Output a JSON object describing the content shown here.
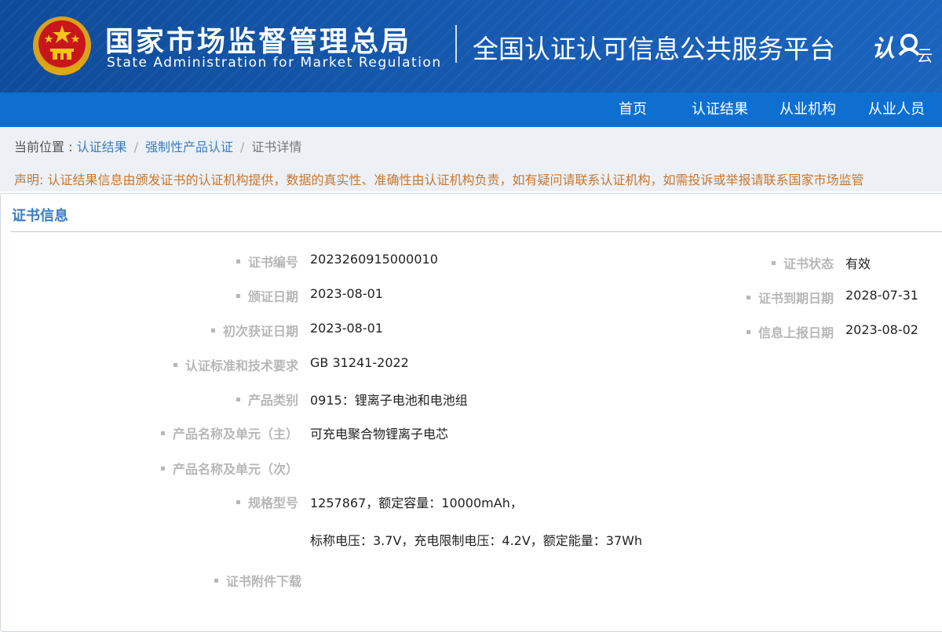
{
  "header": {
    "agency_cn": "国家市场监督管理总局",
    "agency_en": "State Administration  for  Market Regulation",
    "platform_title": "全国认证认可信息公共服务平台",
    "logo_text": "认云"
  },
  "nav": {
    "items": [
      "首页",
      "认证结果",
      "从业机构",
      "从业人员"
    ]
  },
  "breadcrumb": {
    "lead": "当前位置 : ",
    "items": [
      "认证结果",
      "强制性产品认证",
      "证书详情"
    ],
    "separator": "/"
  },
  "notice": "声明: 认证结果信息由颁发证书的认证机构提供，数据的真实性、准确性由认证机构负责，如有疑问请联系认证机构，如需投诉或举报请联系国家市场监管",
  "card": {
    "title": "证书信息",
    "left_fields": [
      {
        "label": "证书编号",
        "value": "2023260915000010"
      },
      {
        "label": "颁证日期",
        "value": "2023-08-01"
      },
      {
        "label": "初次获证日期",
        "value": "2023-08-01"
      },
      {
        "label": "认证标准和技术要求",
        "value": "GB 31241-2022"
      },
      {
        "label": "产品类别",
        "value": "0915：锂离子电池和电池组"
      },
      {
        "label": "产品名称及单元（主）",
        "value": "可充电聚合物锂离子电芯"
      },
      {
        "label": "产品名称及单元（次）",
        "value": ""
      },
      {
        "label": "规格型号",
        "value": "1257867，额定容量：10000mAh，",
        "value2": "标称电压：3.7V，充电限制电压：4.2V，额定能量：37Wh"
      },
      {
        "label": "证书附件下载",
        "value": ""
      }
    ],
    "right_fields": [
      {
        "label": "证书状态",
        "value": "有效"
      },
      {
        "label": "证书到期日期",
        "value": "2028-07-31"
      },
      {
        "label": "信息上报日期",
        "value": "2023-08-02"
      }
    ]
  },
  "colors": {
    "header_bg": "#1558ad",
    "nav_bg": "#0f6fd1",
    "link": "#3b7dc4",
    "notice": "#c9762f",
    "label": "#b7b7b7"
  }
}
